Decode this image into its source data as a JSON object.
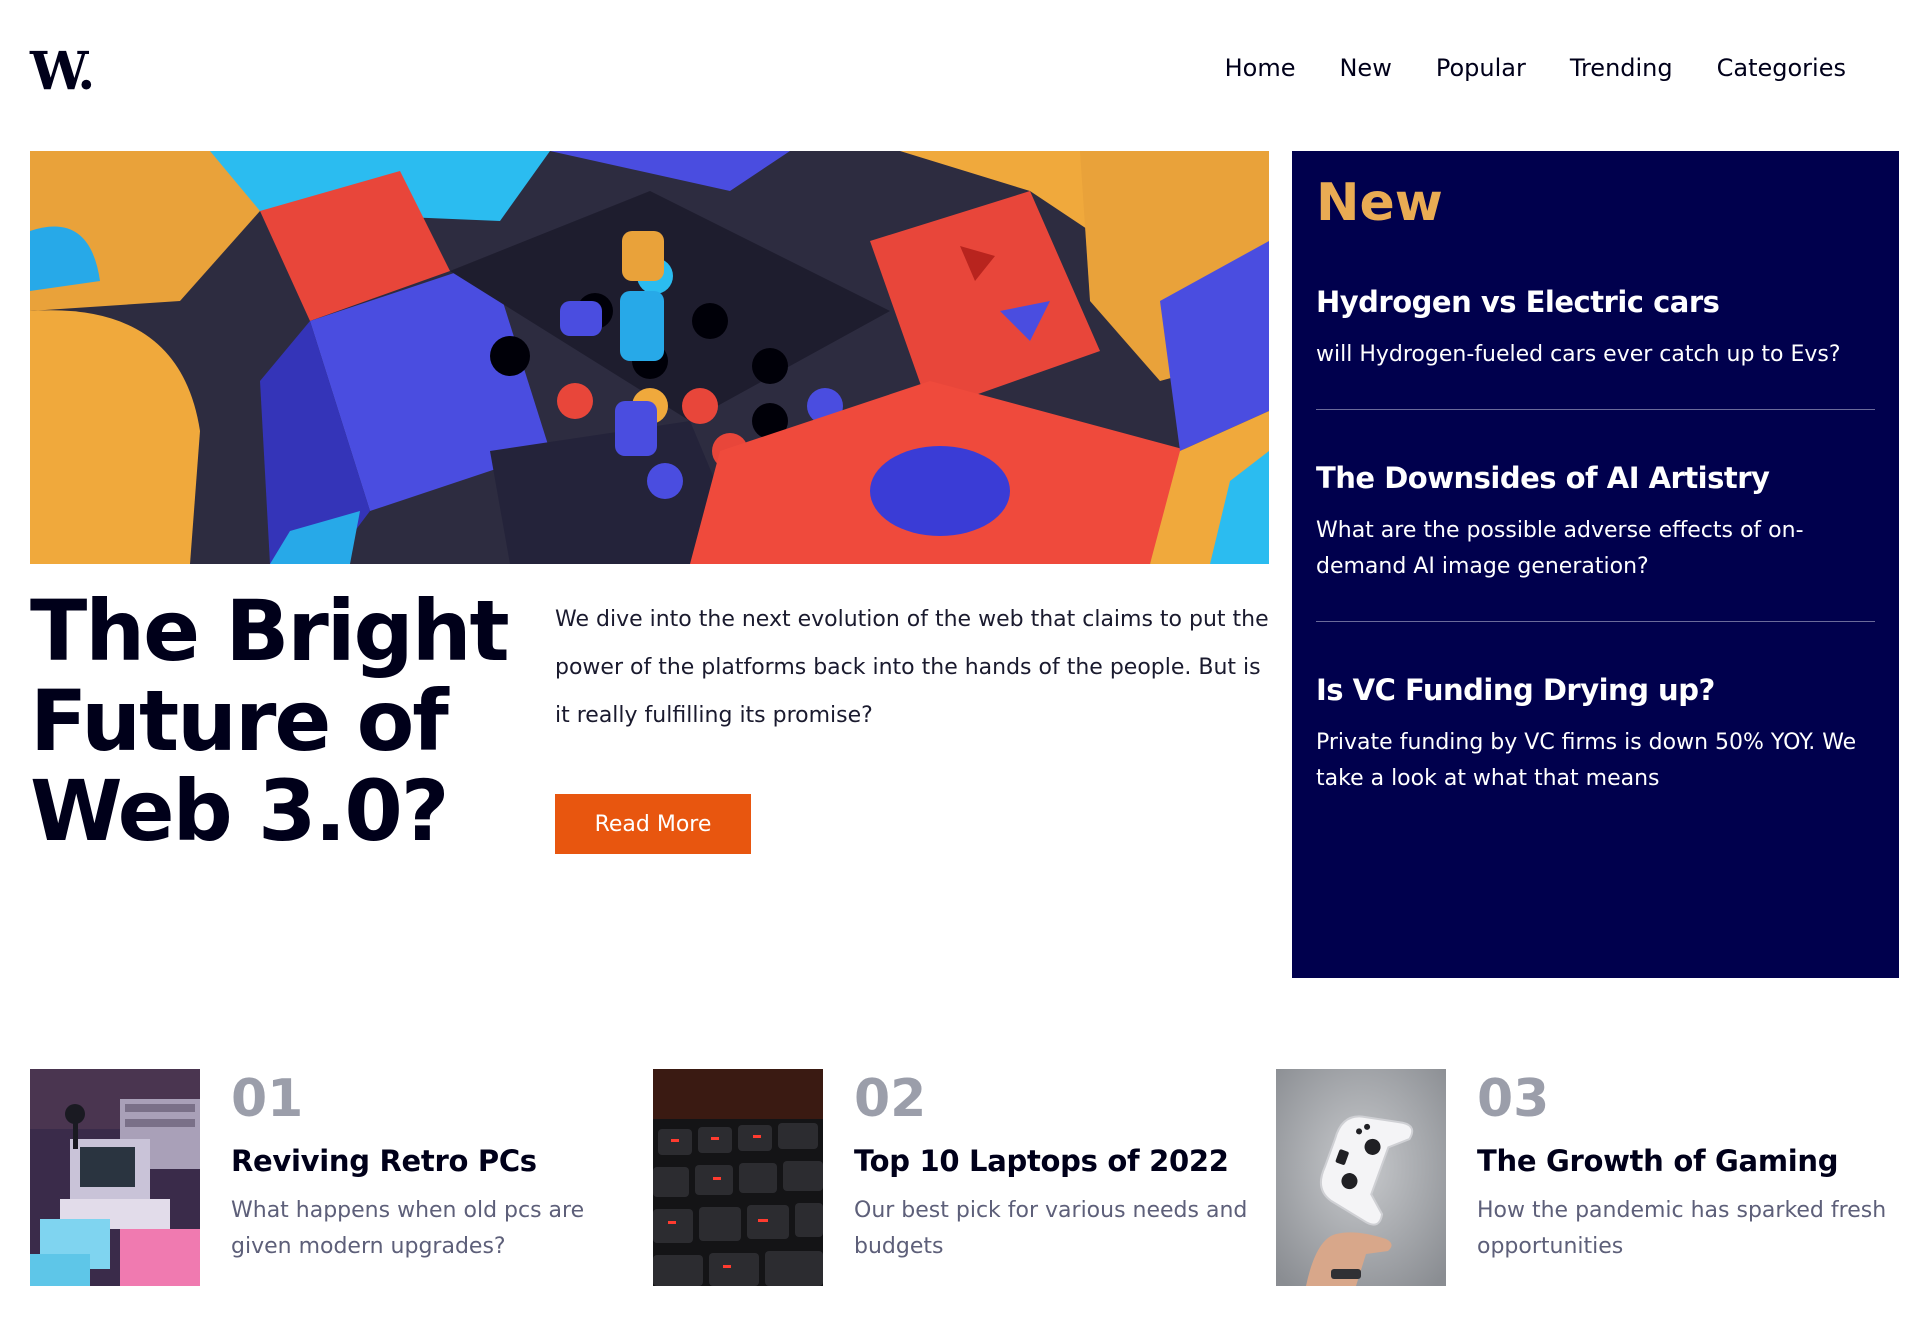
{
  "header": {
    "logo": "W.",
    "nav": [
      "Home",
      "New",
      "Popular",
      "Trending",
      "Categories"
    ]
  },
  "hero": {
    "title": "The Bright Future of Web 3.0?",
    "description": "We dive into the next evolution of the web that claims to put the power of the platforms back into the hands of the people. But is it really fulfilling its promise?",
    "button_label": "Read More"
  },
  "new_panel": {
    "heading": "New",
    "items": [
      {
        "title": "Hydrogen vs Electric cars",
        "text": "will Hydrogen-fueled cars ever catch up to Evs?"
      },
      {
        "title": "The Downsides of AI Artistry",
        "text": "What are the possible adverse effects of on-demand AI image generation?"
      },
      {
        "title": "Is VC Funding Drying up?",
        "text": "Private funding by VC firms is down 50% YOY. We take a look at what that means"
      }
    ]
  },
  "cards": [
    {
      "number": "01",
      "title": "Reviving Retro PCs",
      "text": "What happens when old pcs are given modern upgrades?"
    },
    {
      "number": "02",
      "title": "Top 10 Laptops of 2022",
      "text": "Our best pick for various needs and budgets"
    },
    {
      "number": "03",
      "title": "The Growth of Gaming",
      "text": "How the pandemic has sparked fresh opportunities"
    }
  ],
  "colors": {
    "accent_orange": "#e8560f",
    "panel_navy": "#00004d",
    "new_heading": "#e9ab53",
    "number_gray": "#9b9eaa",
    "text_dark": "#00001a"
  }
}
